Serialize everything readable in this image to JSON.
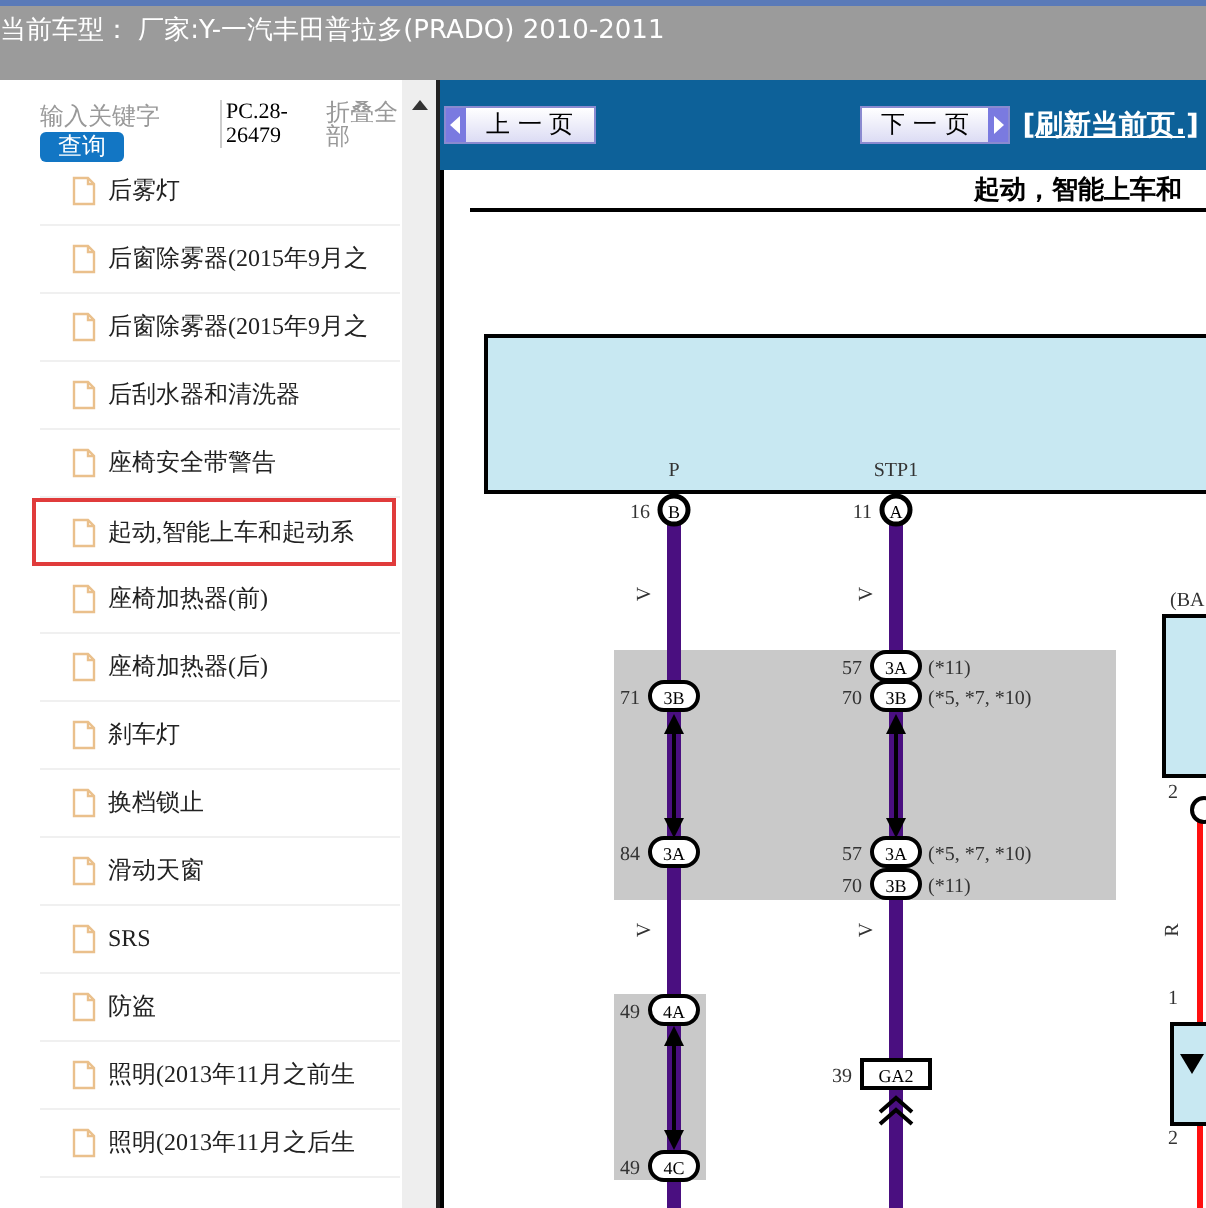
{
  "header": {
    "title": "当前车型： 厂家:Y-一汽丰田普拉多(PRADO) 2010-2011"
  },
  "search": {
    "placeholder": "输入关键字",
    "button": "查询"
  },
  "doc_code": "PC.28-26479",
  "collapse_all": "折叠全部",
  "tree_items": [
    {
      "label": "后雾灯",
      "selected": false
    },
    {
      "label": "后窗除雾器(2015年9月之",
      "selected": false
    },
    {
      "label": "后窗除雾器(2015年9月之",
      "selected": false
    },
    {
      "label": "后刮水器和清洗器",
      "selected": false
    },
    {
      "label": "座椅安全带警告",
      "selected": false
    },
    {
      "label": "起动,智能上车和起动系",
      "selected": true
    },
    {
      "label": "座椅加热器(前)",
      "selected": false
    },
    {
      "label": "座椅加热器(后)",
      "selected": false
    },
    {
      "label": "刹车灯",
      "selected": false
    },
    {
      "label": "换档锁止",
      "selected": false
    },
    {
      "label": "滑动天窗",
      "selected": false
    },
    {
      "label": "SRS",
      "selected": false
    },
    {
      "label": "防盗",
      "selected": false
    },
    {
      "label": "照明(2013年11月之前生",
      "selected": false
    },
    {
      "label": "照明(2013年11月之后生",
      "selected": false
    }
  ],
  "toolbar": {
    "prev": "上 一 页",
    "next": "下 一 页",
    "refresh": "[刷新当前页.]"
  },
  "diagram": {
    "title": "起动，智能上车和",
    "ecu_pins": [
      {
        "signal": "P",
        "pin": "16",
        "terminal": "B"
      },
      {
        "signal": "STP1",
        "pin": "11",
        "terminal": "A"
      }
    ],
    "connectors": [
      {
        "pin": "71",
        "terminal": "3B"
      },
      {
        "pin": "84",
        "terminal": "3A"
      },
      {
        "pin": "49",
        "terminal": "4A"
      },
      {
        "pin": "49",
        "terminal": "4C"
      },
      {
        "pin": "57",
        "terminal": "3A",
        "note": "(*11)"
      },
      {
        "pin": "70",
        "terminal": "3B",
        "note": "(*5, *7, *10)"
      },
      {
        "pin": "57",
        "terminal": "3A",
        "note": "(*5, *7, *10)"
      },
      {
        "pin": "70",
        "terminal": "3B",
        "note": "(*11)"
      },
      {
        "pin": "39",
        "terminal": "GA2",
        "kind": "junction"
      }
    ],
    "wire_labels": [
      "V",
      "V",
      "V",
      "V",
      "R"
    ],
    "side_label": "(BA",
    "side_pins": [
      "2",
      "1",
      "2"
    ]
  }
}
